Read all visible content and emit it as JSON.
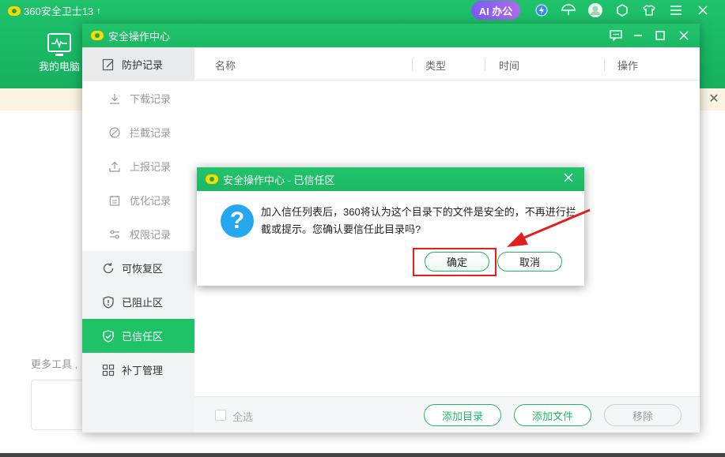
{
  "main": {
    "app_title": "360安全卫士13",
    "up_arrow": "↑",
    "ai_button": "AI 办公",
    "nav_my_pc": "我的电脑",
    "more_tools": "更多工具 ,",
    "top_icons": [
      "lightning-icon",
      "umbrella-icon",
      "avatar-icon",
      "settings-icon",
      "shirt-icon",
      "menu-icon",
      "close-icon"
    ]
  },
  "security_center": {
    "title": "安全操作中心",
    "sidebar": {
      "protection_log": "防护记录",
      "download_log": "下载记录",
      "block_log": "拦截记录",
      "report_log": "上报记录",
      "optimize_log": "优化记录",
      "permission_log": "权限记录",
      "recoverable": "可恢复区",
      "blocked_zone": "已阻止区",
      "trusted_zone": "已信任区",
      "patch_mgmt": "补丁管理"
    },
    "table": {
      "col_name": "名称",
      "col_type": "类型",
      "col_time": "时间",
      "col_action": "操作"
    },
    "footer": {
      "select_all": "全选",
      "add_dir": "添加目录",
      "add_file": "添加文件",
      "remove": "移除"
    }
  },
  "dialog": {
    "title": "安全操作中心 - 已信任区",
    "message": "加入信任列表后，360将认为这个目录下的文件是安全的，不再进行拦截或提示。您确认要信任此目录吗?",
    "confirm": "确定",
    "cancel": "取消",
    "icon": "question-icon"
  },
  "colors": {
    "brand_green": "#1fc266",
    "question_blue": "#25a8f0",
    "annotation_red": "#e0201c",
    "ai_purple": "#8b5cf5"
  }
}
